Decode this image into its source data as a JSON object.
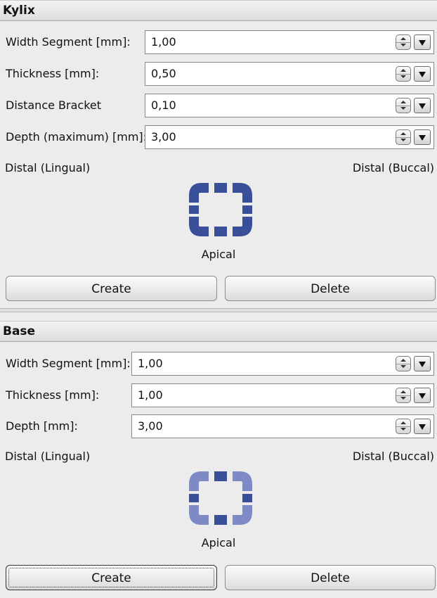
{
  "kylix": {
    "title": "Kylix",
    "fields": [
      {
        "label": "Width Segment [mm]:",
        "value": "1,00"
      },
      {
        "label": "Thickness [mm]:",
        "value": "0,50"
      },
      {
        "label": "Distance Bracket",
        "value": "0,10"
      },
      {
        "label": "Depth (maximum) [mm]:",
        "value": "3,00"
      }
    ],
    "left_label": "Distal (Lingual)",
    "right_label": "Distal (Buccal)",
    "bottom_label": "Apical",
    "icon_color": "#3a4f9a",
    "create_label": "Create",
    "delete_label": "Delete"
  },
  "base": {
    "title": "Base",
    "fields": [
      {
        "label": "Width Segment [mm]:",
        "value": "1,00"
      },
      {
        "label": "Thickness [mm]:",
        "value": "1,00"
      },
      {
        "label": "Depth [mm]:",
        "value": "3,00"
      }
    ],
    "left_label": "Distal (Lingual)",
    "right_label": "Distal (Buccal)",
    "bottom_label": "Apical",
    "icon_color": "#7f89c6",
    "icon_accent": "#3a4f9a",
    "create_label": "Create",
    "delete_label": "Delete"
  }
}
